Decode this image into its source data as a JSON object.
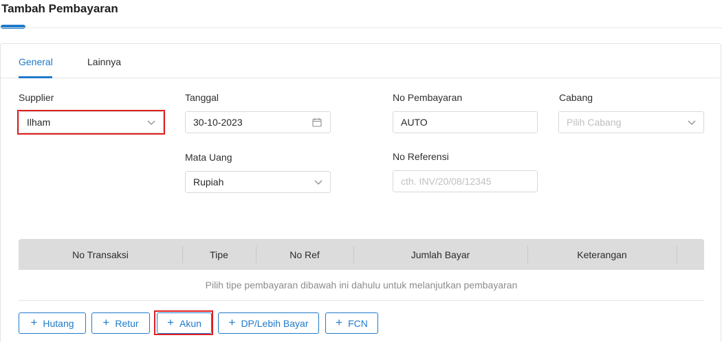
{
  "page": {
    "title": "Tambah Pembayaran"
  },
  "tabs": [
    {
      "label": "General",
      "active": true
    },
    {
      "label": "Lainnya",
      "active": false
    }
  ],
  "form": {
    "supplier": {
      "label": "Supplier",
      "value": "Ilham"
    },
    "tanggal": {
      "label": "Tanggal",
      "value": "30-10-2023"
    },
    "no_pembayaran": {
      "label": "No Pembayaran",
      "value": "AUTO"
    },
    "cabang": {
      "label": "Cabang",
      "placeholder": "Pilih Cabang"
    },
    "mata_uang": {
      "label": "Mata Uang",
      "value": "Rupiah"
    },
    "no_referensi": {
      "label": "No Referensi",
      "placeholder": "cth. INV/20/08/12345"
    }
  },
  "table": {
    "columns": [
      "No Transaksi",
      "Tipe",
      "No Ref",
      "Jumlah Bayar",
      "Keterangan"
    ],
    "empty_message": "Pilih tipe pembayaran dibawah ini dahulu untuk melanjutkan pembayaran"
  },
  "buttons": [
    {
      "label": "Hutang",
      "icon": "plus-icon"
    },
    {
      "label": "Retur",
      "icon": "plus-icon"
    },
    {
      "label": "Akun",
      "icon": "plus-icon"
    },
    {
      "label": "DP/Lebih Bayar",
      "icon": "plus-icon"
    },
    {
      "label": "FCN",
      "icon": "plus-icon"
    }
  ],
  "colors": {
    "accent": "#1e7ac9",
    "highlight": "#e01e1e",
    "table_header": "#dcdcdc"
  }
}
